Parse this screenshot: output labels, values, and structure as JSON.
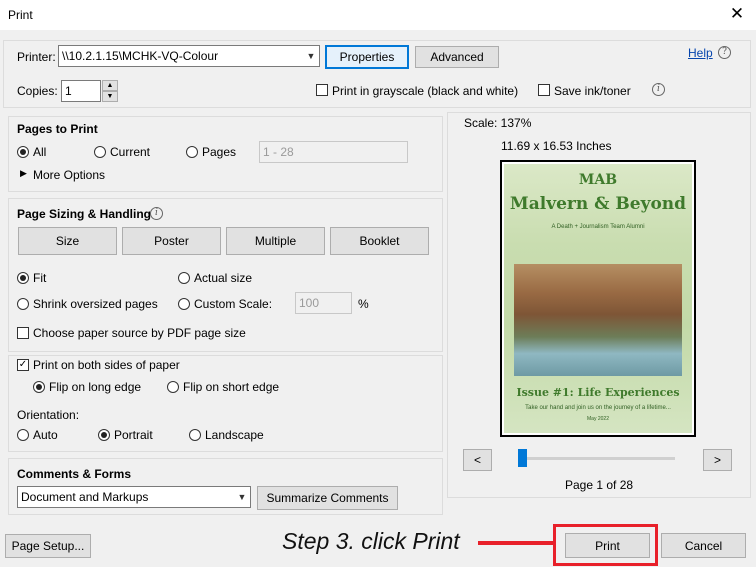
{
  "window": {
    "title": "Print",
    "close_glyph": "✕"
  },
  "printer": {
    "label": "Printer:",
    "value": "\\\\10.2.1.15\\MCHK-VQ-Colour",
    "properties_label": "Properties",
    "advanced_label": "Advanced",
    "help_label": "Help"
  },
  "copies": {
    "label": "Copies:",
    "value": "1"
  },
  "options": {
    "grayscale_label": "Print in grayscale (black and white)",
    "save_ink_label": "Save ink/toner"
  },
  "pages_to_print": {
    "heading": "Pages to Print",
    "all_label": "All",
    "current_label": "Current",
    "pages_label": "Pages",
    "pages_value": "1 - 28",
    "more_options_label": "More Options",
    "selected": "All"
  },
  "sizing": {
    "heading": "Page Sizing & Handling",
    "size_label": "Size",
    "poster_label": "Poster",
    "multiple_label": "Multiple",
    "booklet_label": "Booklet",
    "fit_label": "Fit",
    "actual_size_label": "Actual size",
    "shrink_label": "Shrink oversized pages",
    "custom_scale_label": "Custom Scale:",
    "custom_scale_value": "100",
    "percent": "%",
    "paper_source_label": "Choose paper source by PDF page size",
    "selected": "Fit"
  },
  "duplex": {
    "both_sides_label": "Print on both sides of paper",
    "both_sides_checked": true,
    "long_edge_label": "Flip on long edge",
    "short_edge_label": "Flip on short edge",
    "selected": "Flip on long edge"
  },
  "orientation": {
    "label": "Orientation:",
    "auto_label": "Auto",
    "portrait_label": "Portrait",
    "landscape_label": "Landscape",
    "selected": "Portrait"
  },
  "comments": {
    "heading": "Comments & Forms",
    "value": "Document and Markups",
    "summarize_label": "Summarize Comments"
  },
  "preview": {
    "scale": "Scale: 137%",
    "dimensions": "11.69 x 16.53 Inches",
    "prev_label": "<",
    "next_label": ">",
    "page_indicator": "Page 1 of 28",
    "cover": {
      "mab": "MAB",
      "title": "Malvern & Beyond",
      "subtitle": "A Death + Journalism Team Alumni",
      "issue": "Issue #1: Life Experiences",
      "tagline": "Take our hand and join us on the journey of a lifetime...",
      "date": "May 2022"
    }
  },
  "footer": {
    "page_setup_label": "Page Setup...",
    "print_label": "Print",
    "cancel_label": "Cancel"
  },
  "annotation": {
    "text": "Step 3. click Print",
    "color": "#e8202a"
  }
}
